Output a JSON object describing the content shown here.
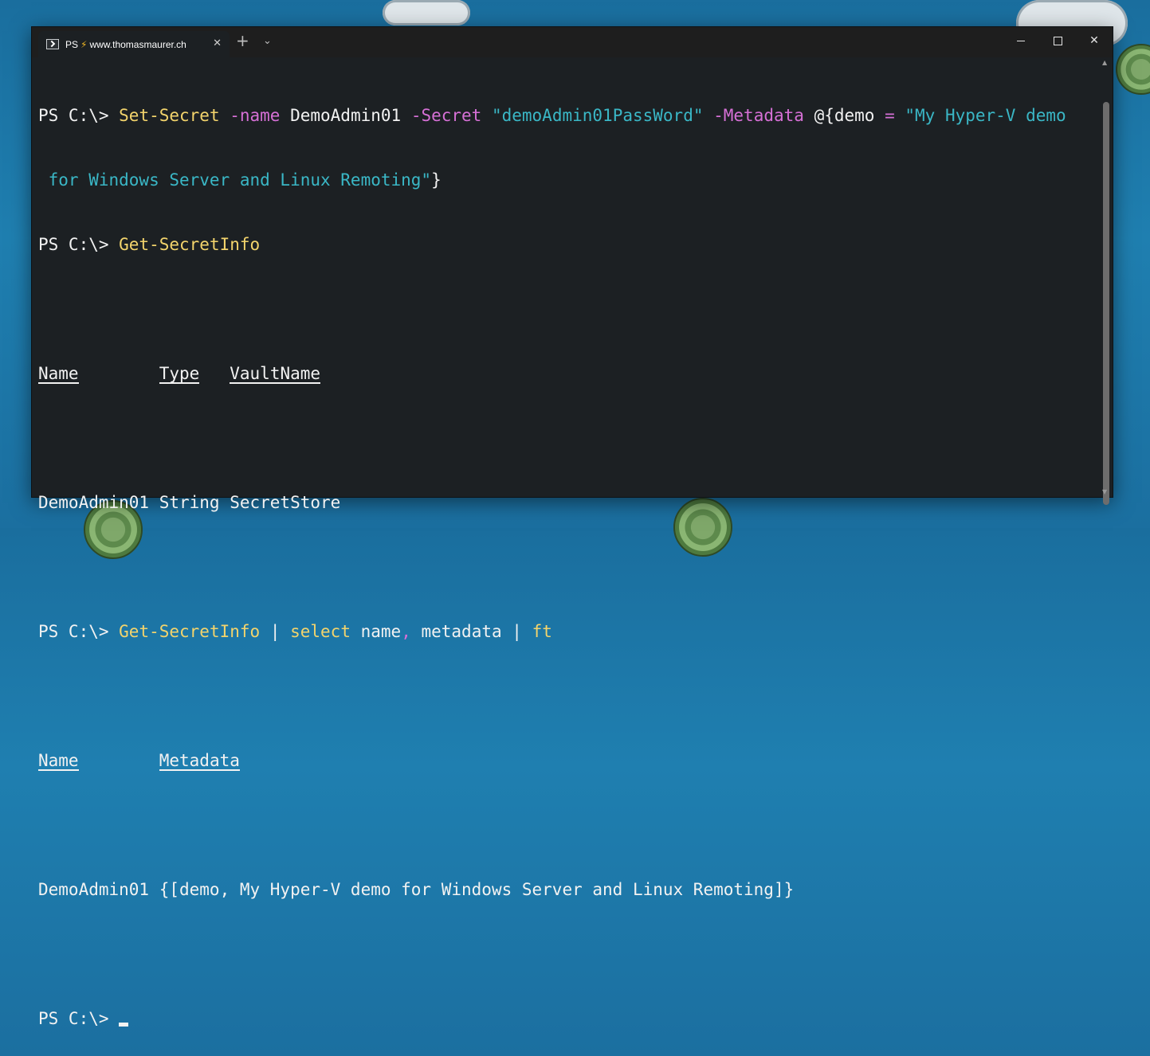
{
  "window": {
    "tab": {
      "prefix": "PS",
      "bolt": "⚡",
      "title": "www.thomasmaurer.ch",
      "close": "✕"
    },
    "new_tab": "+",
    "dropdown": "⌄",
    "controls": {
      "close": "✕"
    }
  },
  "console": {
    "prompt": "PS C:\\> ",
    "line1": {
      "cmd": "Set-Secret",
      "p1": " -name",
      "v1": " DemoAdmin01",
      "p2": " -Secret",
      "s1": " \"demoAdmin01PassWord\"",
      "p3": " -Metadata",
      "t1": " @{demo",
      "op": " =",
      "s2": " \"My Hyper-V demo"
    },
    "line2": {
      "s": " for Windows Server and Linux Remoting\"",
      "t": "}"
    },
    "line3": {
      "cmd": "Get-SecretInfo"
    },
    "table1": {
      "headers": [
        "Name",
        "Type",
        "VaultName"
      ],
      "row": "DemoAdmin01 String SecretStore"
    },
    "line4": {
      "cmd": "Get-SecretInfo",
      "pipe1": " | ",
      "select": "select",
      "a1": " name",
      "comma": ",",
      "a2": " metadata",
      "pipe2": " | ",
      "ft": "ft"
    },
    "table2": {
      "headers": [
        "Name",
        "Metadata"
      ],
      "row": "DemoAdmin01 {[demo, My Hyper-V demo for Windows Server and Linux Remoting]}"
    }
  }
}
